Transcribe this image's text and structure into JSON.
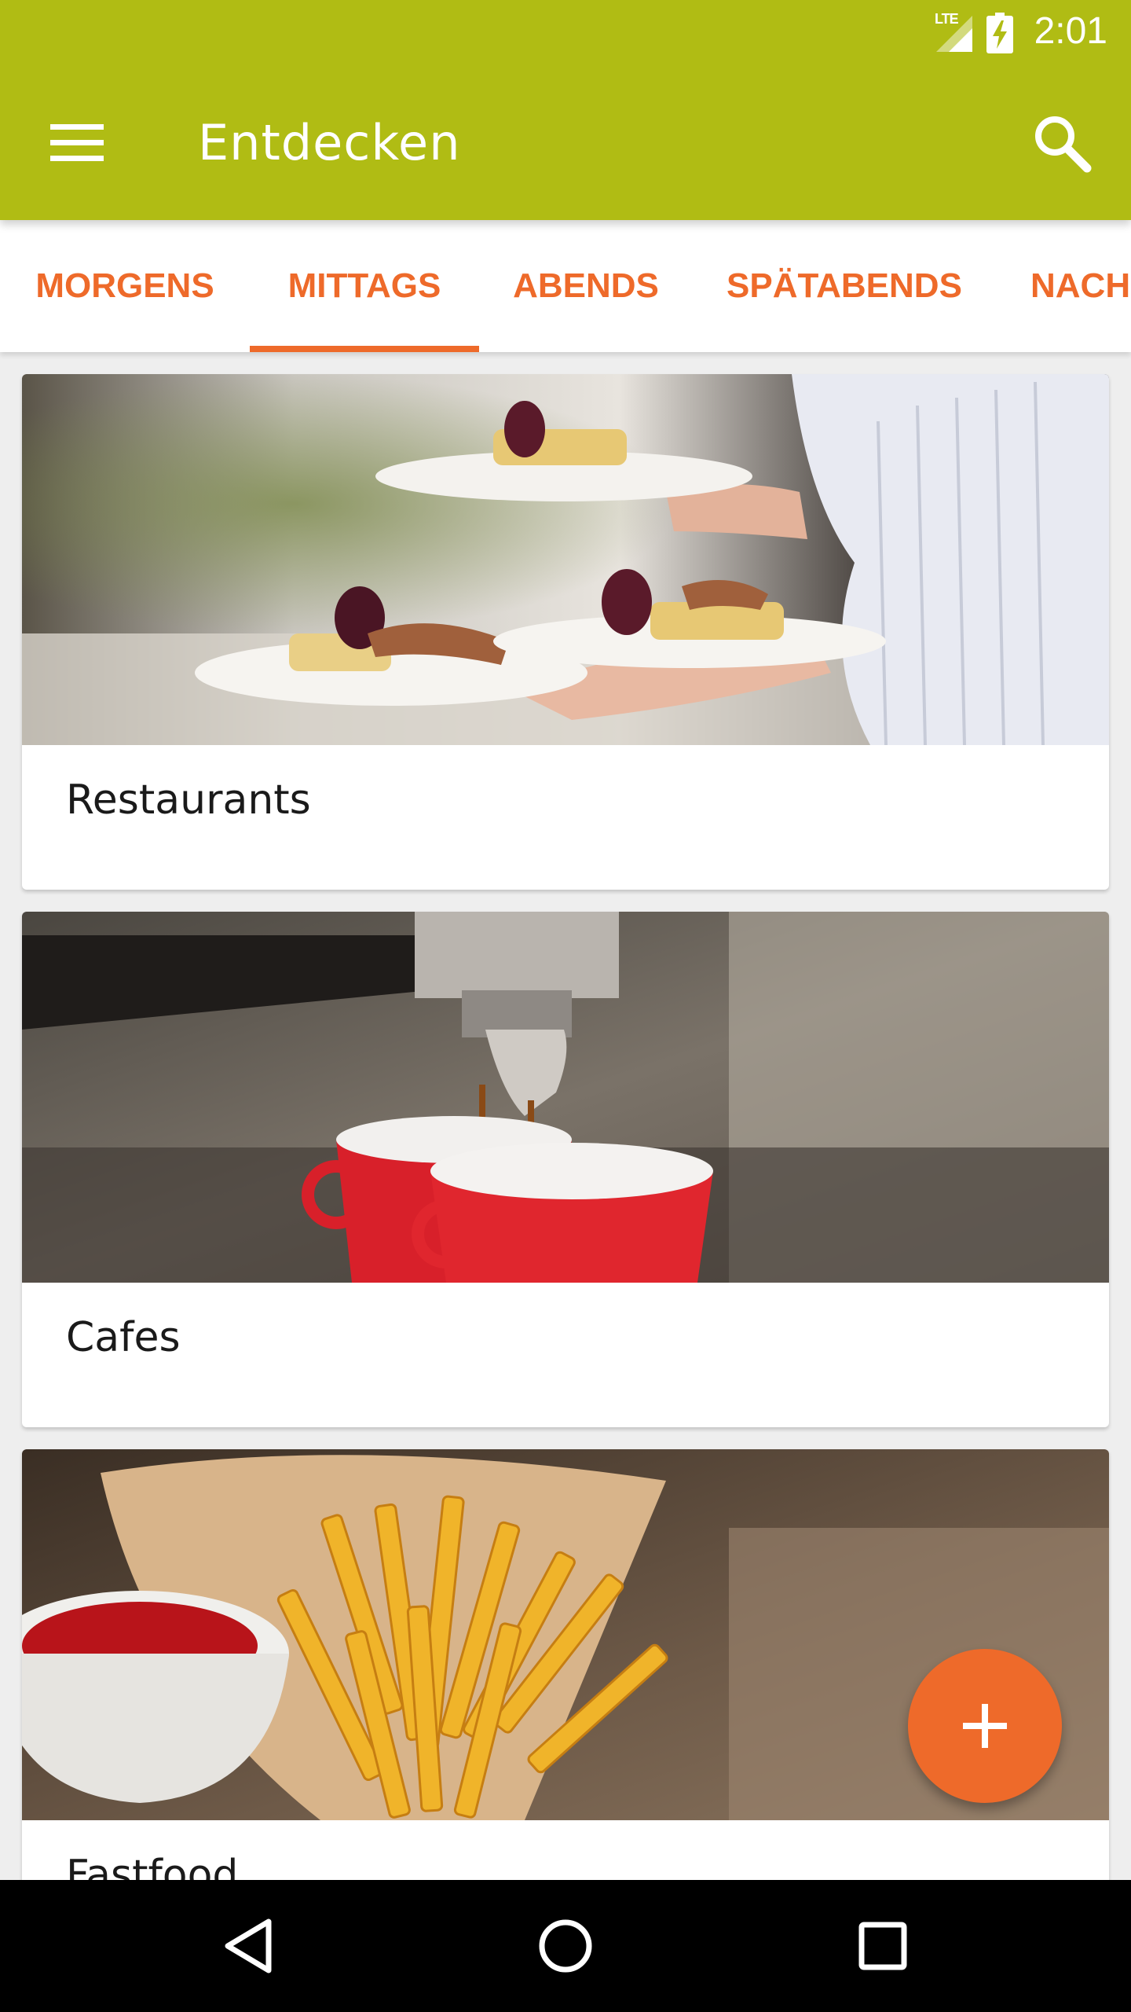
{
  "status_bar": {
    "network": "LTE",
    "time": "2:01"
  },
  "app_bar": {
    "title": "Entdecken",
    "menu_icon": "hamburger-menu-icon",
    "search_icon": "search-icon"
  },
  "tabs": {
    "items": [
      {
        "label": "MORGENS",
        "selected": false
      },
      {
        "label": "MITTAGS",
        "selected": true
      },
      {
        "label": "ABENDS",
        "selected": false
      },
      {
        "label": "SPÄTABENDS",
        "selected": false
      },
      {
        "label": "NACH",
        "selected": false
      }
    ]
  },
  "cards": [
    {
      "label": "Restaurants",
      "image": "restaurant-plates-photo"
    },
    {
      "label": "Cafes",
      "image": "espresso-cups-photo"
    },
    {
      "label": "Fastfood",
      "image": "french-fries-photo"
    }
  ],
  "fab": {
    "icon": "plus-icon"
  },
  "nav": {
    "back_icon": "back-triangle-icon",
    "home_icon": "home-circle-icon",
    "recents_icon": "recents-square-icon"
  },
  "colors": {
    "primary": "#b0bc14",
    "accent": "#ee6a2a",
    "background": "#eeeeee",
    "card": "#ffffff",
    "navbar": "#000000"
  }
}
